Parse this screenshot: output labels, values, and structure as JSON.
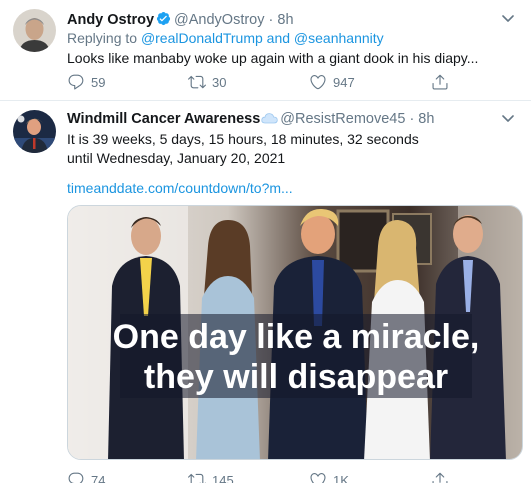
{
  "tweets": [
    {
      "name": "Andy Ostroy",
      "verified": true,
      "handle": "@AndyOstroy",
      "time": "· 8h",
      "replying_prefix": "Replying to",
      "replying_to": "@realDonaldTrump and @seanhannity",
      "text": "Looks like manbaby woke up again with a giant dook in his diapy...",
      "reply_count": "59",
      "retweet_count": "30",
      "like_count": "947"
    },
    {
      "name": "Windmill Cancer Awareness",
      "handle": "@ResistRemove45",
      "time": "· 8h",
      "text_line1": "It is 39 weeks, 5 days, 15 hours, 18 minutes, 32 seconds",
      "text_line2": "until Wednesday, January 20, 2021",
      "link": "timeanddate.com/countdown/to?m...",
      "media_caption_line1": "One day like a miracle,",
      "media_caption_line2": "they will disappear",
      "reply_count": "74",
      "retweet_count": "145",
      "like_count": "1K"
    }
  ],
  "colors": {
    "link": "#1b95e0",
    "secondary_text": "#657786",
    "divider": "#e6ecf0"
  },
  "icons": [
    "more-icon",
    "verified-badge-icon",
    "reply-icon",
    "retweet-icon",
    "like-icon",
    "share-icon",
    "cloud-emoji-icon"
  ]
}
